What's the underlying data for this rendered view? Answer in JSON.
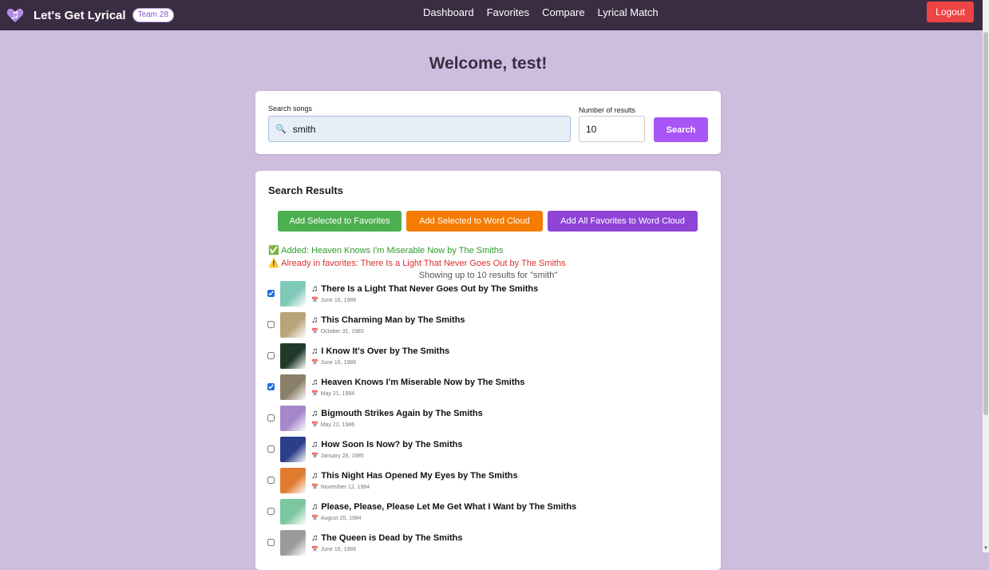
{
  "navbar": {
    "brand_title": "Let's Get Lyrical",
    "team_badge": "Team 28",
    "links": [
      "Dashboard",
      "Favorites",
      "Compare",
      "Lyrical Match"
    ],
    "logout_label": "Logout"
  },
  "welcome": "Welcome, test!",
  "search": {
    "label": "Search songs",
    "value": "smith",
    "num_label": "Number of results",
    "num_value": "10",
    "button_label": "Search"
  },
  "results": {
    "title": "Search Results",
    "btn_add_fav": "Add Selected to Favorites",
    "btn_add_cloud": "Add Selected to Word Cloud",
    "btn_add_all": "Add All Favorites to Word Cloud",
    "msg_added": "Added: Heaven Knows I'm Miserable Now by The Smiths",
    "msg_warn": "Already in favorites: There Is a Light That Never Goes Out by The Smiths",
    "showing": "Showing up to 10 results for \"smith\"",
    "songs": [
      {
        "title": "There Is a Light That Never Goes Out by The Smiths",
        "date": "June 16, 1986",
        "checked": true,
        "cover": "#7fc9b9"
      },
      {
        "title": "This Charming Man by The Smiths",
        "date": "October 31, 1983",
        "checked": false,
        "cover": "#b9a47a"
      },
      {
        "title": "I Know It's Over by The Smiths",
        "date": "June 16, 1986",
        "checked": false,
        "cover": "#1f3a2a"
      },
      {
        "title": "Heaven Knows I'm Miserable Now by The Smiths",
        "date": "May 21, 1984",
        "checked": true,
        "cover": "#8a8069"
      },
      {
        "title": "Bigmouth Strikes Again by The Smiths",
        "date": "May 22, 1986",
        "checked": false,
        "cover": "#a488c9"
      },
      {
        "title": "How Soon Is Now? by The Smiths",
        "date": "January 28, 1985",
        "checked": false,
        "cover": "#2a3e8a"
      },
      {
        "title": "This Night Has Opened My Eyes by The Smiths",
        "date": "November 12, 1984",
        "checked": false,
        "cover": "#e07a2e"
      },
      {
        "title": "Please, Please, Please Let Me Get What I Want by The Smiths",
        "date": "August 20, 1984",
        "checked": false,
        "cover": "#7dc7a0"
      },
      {
        "title": "The Queen is Dead by The Smiths",
        "date": "June 16, 1986",
        "checked": false,
        "cover": "#9a9a9a"
      }
    ]
  },
  "colors": {
    "navbar_bg": "#3a2d42",
    "page_bg": "#cdbedd",
    "accent": "#a855f7",
    "logout": "#ef4444"
  }
}
